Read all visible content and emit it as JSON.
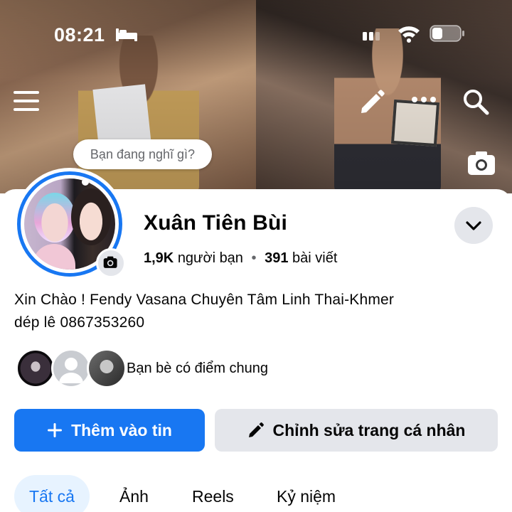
{
  "status_bar": {
    "time": "08:21"
  },
  "composer": {
    "placeholder": "Bạn đang nghĩ gì?"
  },
  "profile": {
    "name": "Xuân Tiên Bùi",
    "friends_count": "1,9K",
    "friends_label": "người bạn",
    "separator": "•",
    "posts_count": "391",
    "posts_label": "bài viết",
    "bio_line1": "Xin Chào ! Fendy Vasana Chuyên Tâm Linh Thai-Khmer",
    "bio_line2": "dép lê 0867353260",
    "mutual_friends_label": "Bạn bè có điểm chung"
  },
  "actions": {
    "add_story_label": "Thêm vào tin",
    "edit_profile_label": "Chỉnh sửa trang cá nhân"
  },
  "tabs": [
    {
      "label": "Tất cả",
      "active": true
    },
    {
      "label": "Ảnh",
      "active": false
    },
    {
      "label": "Reels",
      "active": false
    },
    {
      "label": "Kỷ niệm",
      "active": false
    }
  ],
  "colors": {
    "accent": "#1877f2",
    "secondary_button": "#e4e6eb",
    "active_tab_bg": "#e7f3ff",
    "text": "#050505",
    "muted_text": "#65676b"
  },
  "icons": [
    "bed-icon",
    "signal-icon",
    "wifi-icon",
    "battery-icon",
    "menu-icon",
    "edit-icon",
    "more-icon",
    "search-icon",
    "camera-icon",
    "chevron-down-icon",
    "plus-icon",
    "pencil-icon"
  ]
}
